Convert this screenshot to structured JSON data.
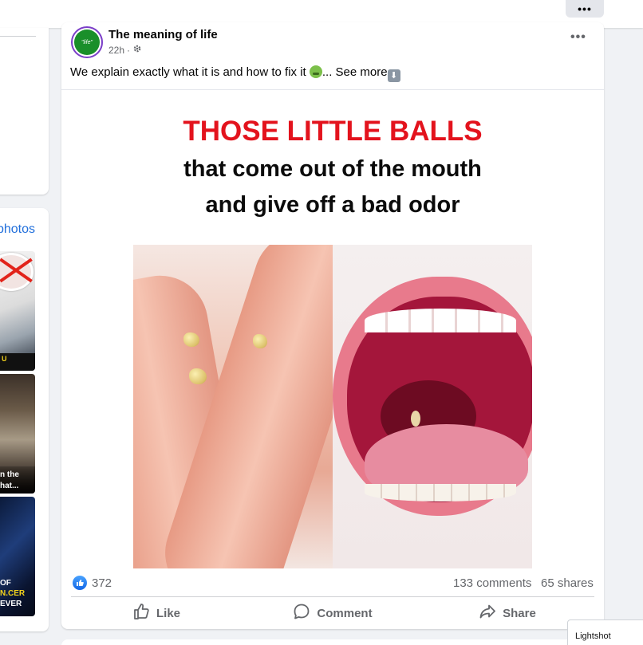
{
  "topbar": {
    "more_icon": "ellipsis-icon",
    "more_label": "•••"
  },
  "left_column": {
    "photos_link": "photos",
    "thumb1_caption": "U",
    "thumb2_caption_1": "n the",
    "thumb2_caption_2": "hat...",
    "thumb3_caption_1": "OF",
    "thumb3_caption_2": "N.CER",
    "thumb3_caption_3": "EVER"
  },
  "post": {
    "page_name": "The meaning of life",
    "avatar_text": "\"life\"",
    "time": "22h",
    "audience_icon": "gear-icon",
    "more_label": "•••",
    "text_main": "We explain exactly what it is and how to fix it ",
    "text_ellipsis": "... See more",
    "down_arrow": "⬇",
    "image": {
      "headline_red": "THOSE LITTLE BALLS",
      "headline_line2": "that come out of the mouth",
      "headline_line3": "and give off a bad odor"
    },
    "reactions": {
      "count": "372",
      "comments": "133 comments",
      "shares": "65 shares"
    },
    "actions": {
      "like": "Like",
      "comment": "Comment",
      "share": "Share"
    }
  },
  "lightshot": {
    "label": "Lightshot"
  },
  "colors": {
    "accent": "#1877f2",
    "headline_red": "#e3131d",
    "link": "#216fdb"
  }
}
